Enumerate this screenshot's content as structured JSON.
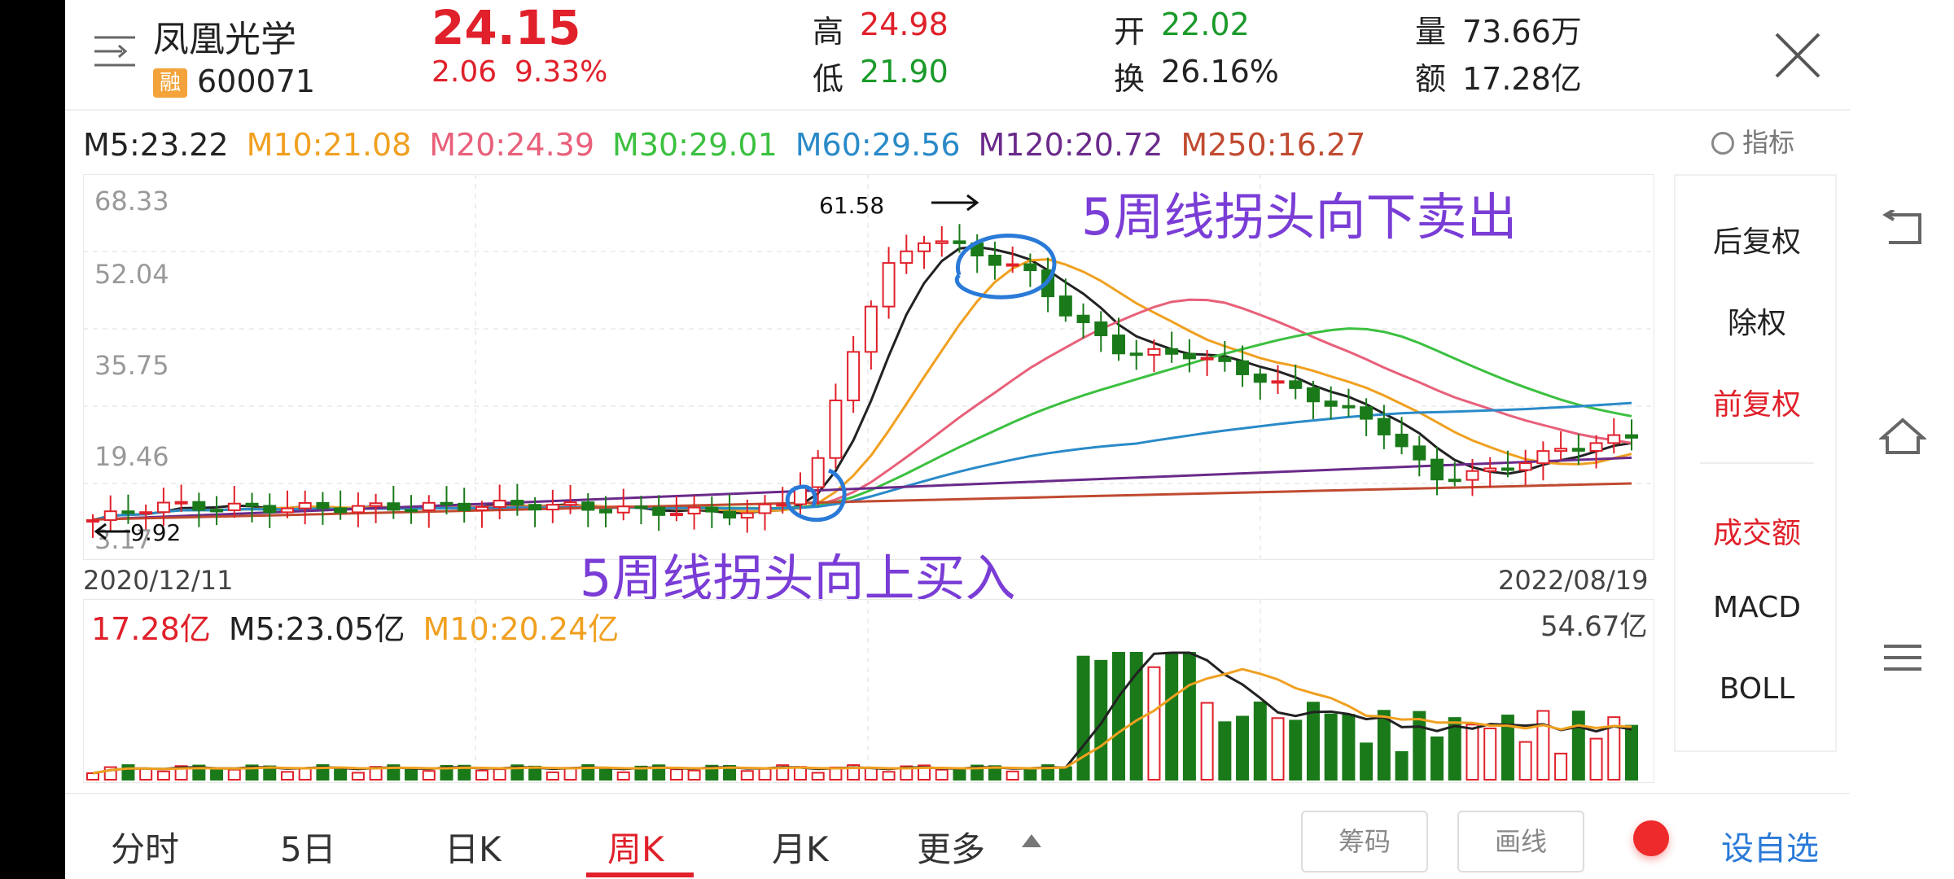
{
  "header": {
    "stock_name": "凤凰光学",
    "margin_badge": "融",
    "stock_code": "600071",
    "price": "24.15",
    "change": "2.06",
    "change_pct": "9.33%",
    "high_label": "高",
    "high_value": "24.98",
    "low_label": "低",
    "low_value": "21.90",
    "open_label": "开",
    "open_value": "22.02",
    "turnover_label": "换",
    "turnover_value": "26.16%",
    "volume_label": "量",
    "volume_value": "73.66万",
    "amount_label": "额",
    "amount_value": "17.28亿"
  },
  "ma_bar": {
    "items": [
      {
        "text": "M5:23.22",
        "color": "#222222"
      },
      {
        "text": "M10:21.08",
        "color": "#f0a020"
      },
      {
        "text": "M20:24.39",
        "color": "#e8607a"
      },
      {
        "text": "M30:29.01",
        "color": "#3cc040"
      },
      {
        "text": "M60:29.56",
        "color": "#2a8ac8"
      },
      {
        "text": "M120:20.72",
        "color": "#6a2a8a"
      },
      {
        "text": "M250:16.27",
        "color": "#c04a30"
      }
    ],
    "indicator_label": "指标"
  },
  "chart_axis": {
    "y_ticks": [
      "68.33",
      "52.04",
      "35.75",
      "19.46",
      "3.17"
    ],
    "date_start": "2020/12/11",
    "date_end": "2022/08/19",
    "high_marker": "61.58",
    "low_marker": "9.92"
  },
  "annotations": {
    "sell_text": "5周线拐头向下卖出",
    "buy_text": "5周线拐头向上买入"
  },
  "volume_legend": {
    "current": "17.28亿",
    "m5": "M5:23.05亿",
    "m10": "M10:20.24亿",
    "max": "54.67亿"
  },
  "side_panel": {
    "items": [
      "后复权",
      "除权",
      "前复权",
      "成交额",
      "MACD",
      "BOLL"
    ],
    "active_color": "#e0202a"
  },
  "bottom_tabs": {
    "tabs": [
      "分时",
      "5日",
      "日K",
      "周K",
      "月K",
      "更多"
    ],
    "active": "周K",
    "chip_button": "筹码",
    "draw_button": "画线",
    "add_watchlist": "设自选"
  },
  "chart_data": {
    "type": "candlestick",
    "x_range": [
      "2020/12/11",
      "2022/08/19"
    ],
    "ylim": [
      3.17,
      68.33
    ],
    "y_ticks": [
      68.33,
      52.04,
      35.75,
      19.46,
      3.17
    ],
    "highest": 61.58,
    "lowest": 9.92,
    "series": [
      {
        "name": "M5",
        "last": 23.22
      },
      {
        "name": "M10",
        "last": 21.08
      },
      {
        "name": "M20",
        "last": 24.39
      },
      {
        "name": "M30",
        "last": 29.01
      },
      {
        "name": "M60",
        "last": 29.56
      },
      {
        "name": "M120",
        "last": 20.72
      },
      {
        "name": "M250",
        "last": 16.27
      }
    ],
    "volume": {
      "last": "17.28亿",
      "m5": "23.05亿",
      "m10": "20.24亿",
      "max": "54.67亿"
    }
  }
}
